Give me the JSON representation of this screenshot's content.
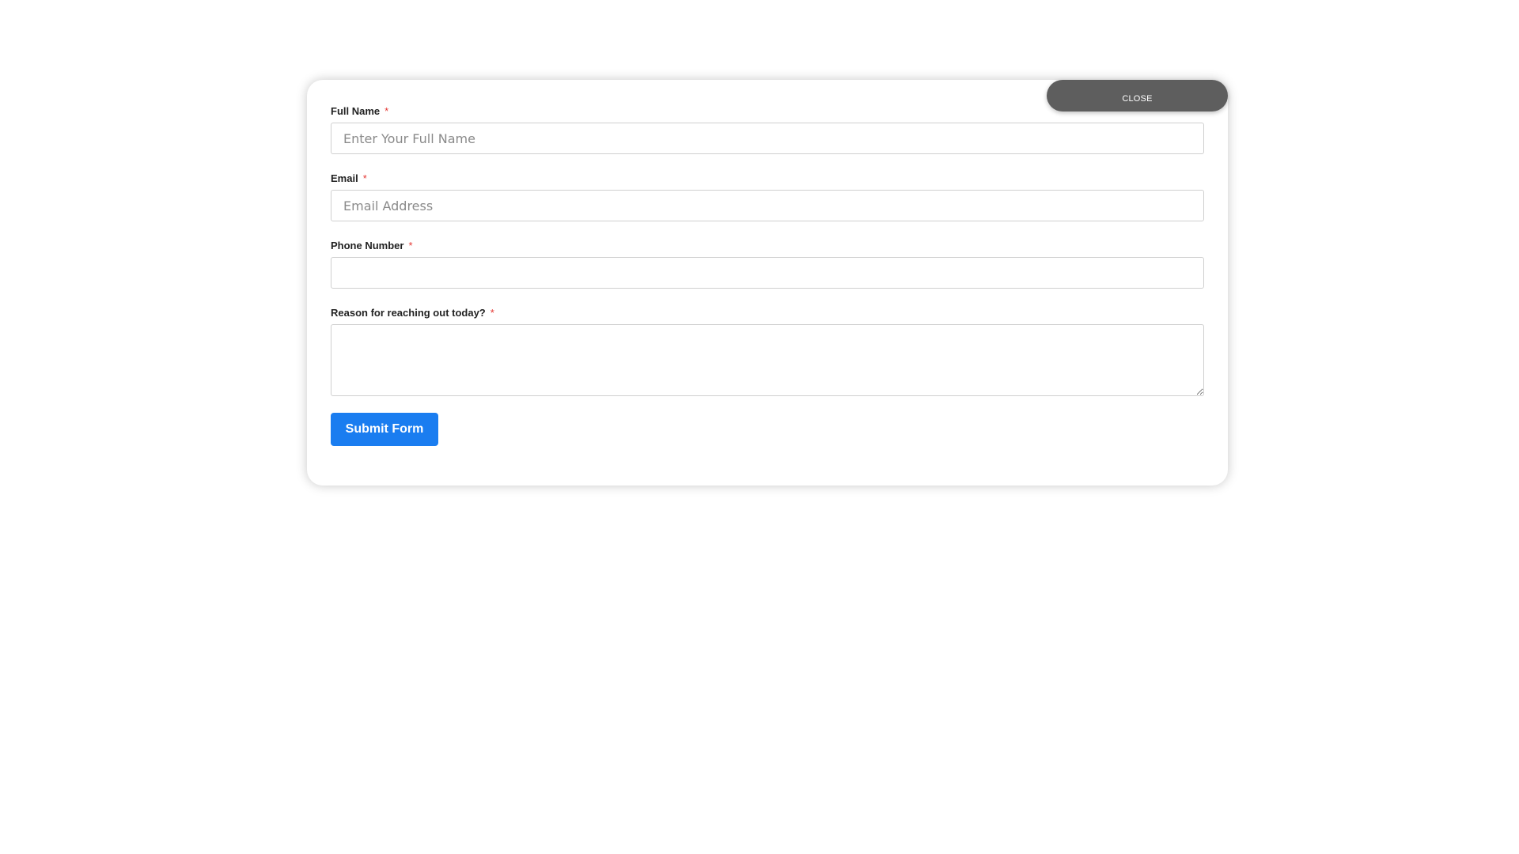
{
  "modal": {
    "close_label": "CLOSE"
  },
  "form": {
    "fields": [
      {
        "label": "Full Name",
        "required_mark": "*",
        "placeholder": "Enter Your Full Name",
        "value": ""
      },
      {
        "label": "Email",
        "required_mark": "*",
        "placeholder": "Email Address",
        "value": ""
      },
      {
        "label": "Phone Number",
        "required_mark": "*",
        "placeholder": "",
        "value": ""
      },
      {
        "label": "Reason for reaching out today?",
        "required_mark": "*",
        "placeholder": "",
        "value": ""
      }
    ],
    "submit_label": "Submit Form"
  },
  "colors": {
    "accent": "#1a7df0",
    "required": "#e53935",
    "close_button": "#5e5e5e"
  }
}
